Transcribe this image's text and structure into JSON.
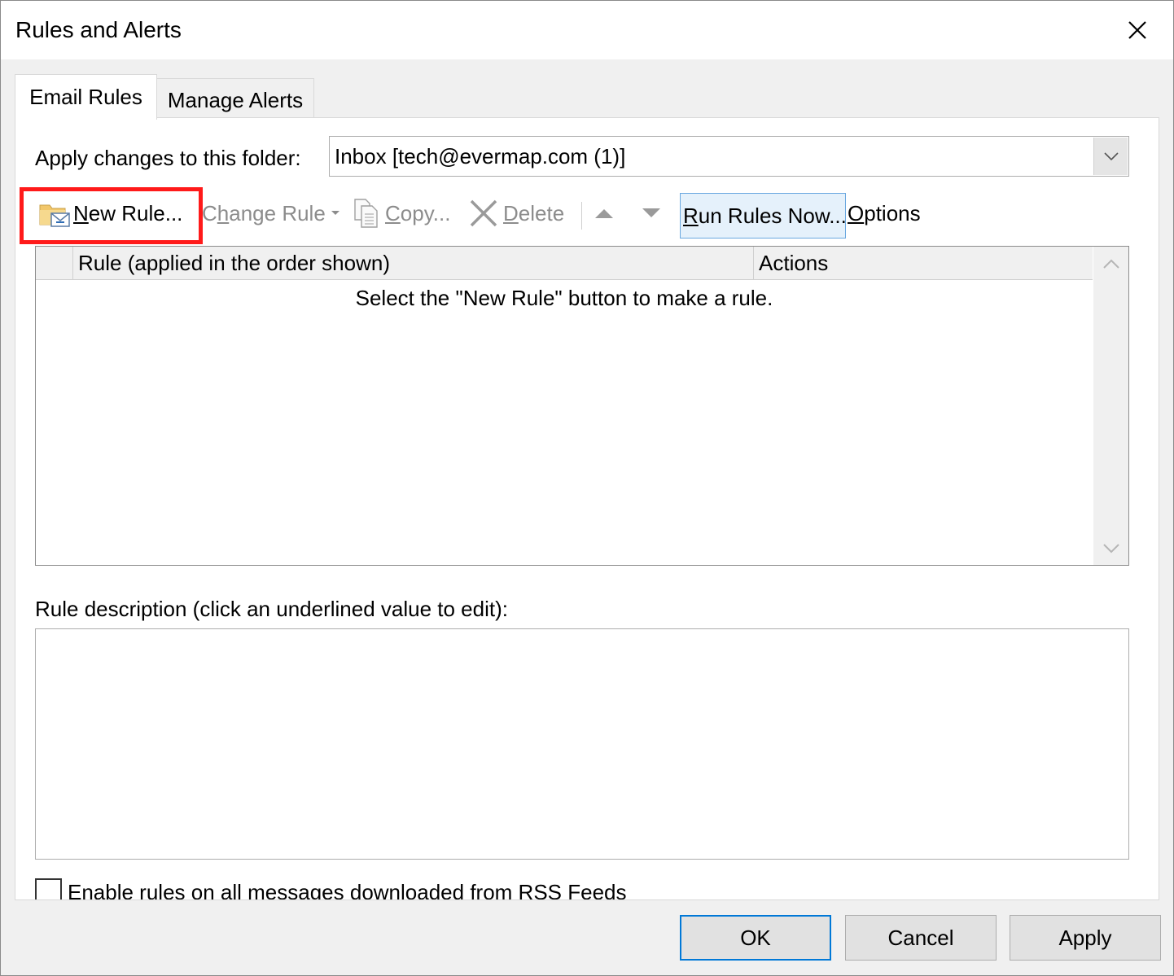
{
  "window": {
    "title": "Rules and Alerts",
    "close_icon": "close-icon"
  },
  "tabs": [
    {
      "label": "Email Rules",
      "active": true
    },
    {
      "label": "Manage Alerts",
      "active": false
    }
  ],
  "folder": {
    "label": "Apply changes to this folder:",
    "value": "Inbox [tech@evermap.com (1)]"
  },
  "toolbar": {
    "new_rule": {
      "mnemonic": "N",
      "rest": "ew Rule...",
      "icon": "new-rule-icon",
      "enabled": true
    },
    "change_rule": {
      "pre": "C",
      "mnemonic": "h",
      "rest": "ange Rule",
      "enabled": false
    },
    "copy": {
      "mnemonic": "C",
      "rest": "opy...",
      "icon": "copy-icon",
      "enabled": false
    },
    "delete": {
      "mnemonic": "D",
      "rest": "elete",
      "icon": "delete-x-icon",
      "enabled": false
    },
    "move_up_icon": "arrow-up-icon",
    "move_down_icon": "arrow-down-icon",
    "run_rules_now": {
      "mnemonic": "R",
      "rest": "un Rules Now...",
      "enabled": true
    },
    "options": {
      "mnemonic": "O",
      "rest": "ptions",
      "enabled": true
    }
  },
  "rules_list": {
    "columns": [
      "Rule (applied in the order shown)",
      "Actions"
    ],
    "empty_message": "Select the \"New Rule\" button to make a rule.",
    "rows": []
  },
  "description": {
    "label": "Rule description (click an underlined value to edit):",
    "text": ""
  },
  "rss": {
    "label": "Enable rules on all messages downloaded from RSS Feeds",
    "checked": false
  },
  "buttons": {
    "ok": "OK",
    "cancel": "Cancel",
    "apply": "Apply"
  },
  "colors": {
    "highlight": "#ff1a1a",
    "focus_blue": "#0078d7",
    "hover_bg": "#e5f1fb",
    "disabled_text": "#8c8c8c"
  }
}
